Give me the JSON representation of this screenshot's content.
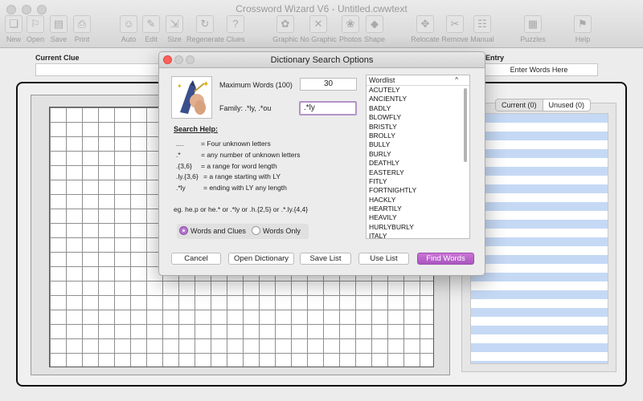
{
  "window": {
    "title": "Crossword Wizard V6 - Untitled.cwwtext"
  },
  "toolbar": {
    "items": [
      {
        "label": "New",
        "icon": "new-icon",
        "glyph": "❏"
      },
      {
        "label": "Open",
        "icon": "open-icon",
        "glyph": "⚐"
      },
      {
        "label": "Save",
        "icon": "save-icon",
        "glyph": "▤"
      },
      {
        "label": "Print",
        "icon": "print-icon",
        "glyph": "⎙"
      },
      {
        "label": "Auto",
        "icon": "auto-icon",
        "glyph": "☺"
      },
      {
        "label": "Edit",
        "icon": "edit-icon",
        "glyph": "✎"
      },
      {
        "label": "Size",
        "icon": "size-icon",
        "glyph": "⇲"
      },
      {
        "label": "Regenerate",
        "icon": "regenerate-icon",
        "glyph": "↻"
      },
      {
        "label": "Clues",
        "icon": "clues-icon",
        "glyph": "?"
      },
      {
        "label": "Graphic",
        "icon": "graphic-icon",
        "glyph": "✿"
      },
      {
        "label": "No Graphic",
        "icon": "no-graphic-icon",
        "glyph": "✕"
      },
      {
        "label": "Photos",
        "icon": "photos-icon",
        "glyph": "❀"
      },
      {
        "label": "Shape",
        "icon": "shape-icon",
        "glyph": "◆"
      },
      {
        "label": "Relocate",
        "icon": "relocate-icon",
        "glyph": "✥"
      },
      {
        "label": "Remove",
        "icon": "remove-icon",
        "glyph": "✂"
      },
      {
        "label": "Manual",
        "icon": "manual-icon",
        "glyph": "☷"
      },
      {
        "label": "Puzzles",
        "icon": "puzzles-icon",
        "glyph": "▦"
      },
      {
        "label": "Help",
        "icon": "help-icon",
        "glyph": "⚑"
      }
    ]
  },
  "main": {
    "current_clue_label": "Current Clue",
    "entry_label": "Entry",
    "enter_words_placeholder": "Enter Words Here",
    "tabs": [
      {
        "label": "Current (0)",
        "active": true
      },
      {
        "label": "Unused (0)",
        "active": false
      }
    ]
  },
  "dialog": {
    "title": "Dictionary Search Options",
    "max_words_label": "Maximum Words (100)",
    "max_words_value": "30",
    "family_label": "Family:  .*ly, .*ou",
    "family_value": ".*ly",
    "help_heading": "Search Help:",
    "help_rows": [
      {
        "pattern": "....",
        "description": "=  Four  unknown letters"
      },
      {
        "pattern": ".*",
        "description": "=  any number of unknown letters"
      },
      {
        "pattern": ".{3,6}",
        "description": "=  a range for word length"
      },
      {
        "pattern": ".ly.{3,6}",
        "description": "= a range starting with LY"
      },
      {
        "pattern": ".*ly",
        "description": "= ending with LY any length"
      }
    ],
    "example": "eg.    he.p   or he.* or .*ly or .h.{2,5} or .*.ly.{4,4}",
    "radio_words_and_clues": "Words and Clues",
    "radio_words_only": "Words Only",
    "wordlist_header": "Wordlist",
    "wordlist": [
      "ACUTELY",
      "ANCIENTLY",
      "BADLY",
      "BLOWFLY",
      "BRISTLY",
      "BROLLY",
      "BULLY",
      "BURLY",
      "DEATHLY",
      "EASTERLY",
      "FITLY",
      "FORTNIGHTLY",
      "HACKLY",
      "HEARTILY",
      "HEAVILY",
      "HURLYBURLY",
      "ITALY"
    ],
    "buttons": {
      "cancel": "Cancel",
      "open_dictionary": "Open Dictionary",
      "save_list": "Save List",
      "use_list": "Use List",
      "find_words": "Find Words"
    }
  },
  "colors": {
    "accent_purple": "#b476cb",
    "close_red": "#fc605b",
    "stripe_blue": "#c5d9f5"
  }
}
